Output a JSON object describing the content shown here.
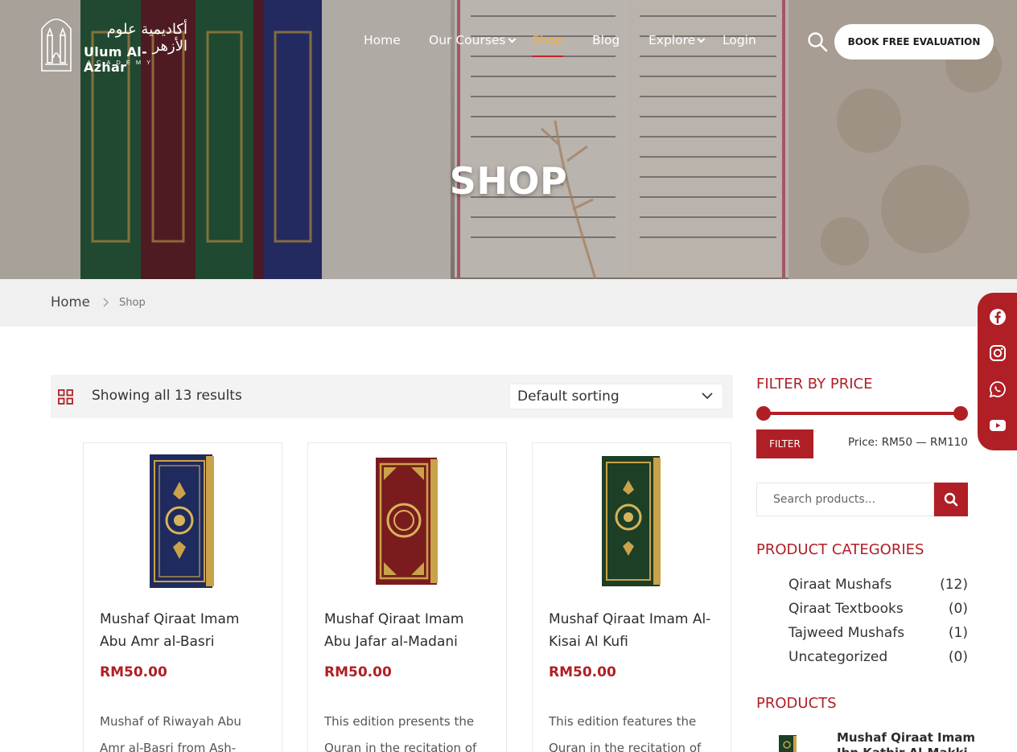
{
  "header": {
    "logo": {
      "name": "Ulum Al-Azhar",
      "tagline": "ACADEMY",
      "arabic": "أكاديمية علوم الأزهر"
    },
    "nav": [
      {
        "label": "Home",
        "dropdown": false,
        "active": false
      },
      {
        "label": "Our Courses",
        "dropdown": true,
        "active": false
      },
      {
        "label": "Shop",
        "dropdown": false,
        "active": true
      },
      {
        "label": "Blog",
        "dropdown": false,
        "active": false
      },
      {
        "label": "Explore",
        "dropdown": true,
        "active": false
      },
      {
        "label": "Login",
        "dropdown": false,
        "active": false
      }
    ],
    "search_icon": "search-icon",
    "cta_label": "BOOK FREE EVALUATION"
  },
  "hero": {
    "title": "SHOP"
  },
  "breadcrumb": {
    "home": "Home",
    "current": "Shop"
  },
  "social": [
    "facebook-icon",
    "instagram-icon",
    "whatsapp-icon",
    "youtube-icon"
  ],
  "toolbar": {
    "results_text": "Showing all 13 results",
    "sort_selected": "Default sorting"
  },
  "products": [
    {
      "title": "Mushaf Qiraat Imam Abu Amr al-Basri",
      "price": "RM50.00",
      "description": "Mushaf of Riwayah Abu Amr al-Basri from Ash-",
      "cover_color": "#1f2a5e"
    },
    {
      "title": "Mushaf Qiraat Imam Abu Jafar al-Madani",
      "price": "RM50.00",
      "description": "This edition presents the Quran in the recitation of",
      "cover_color": "#7a1c1e"
    },
    {
      "title": "Mushaf Qiraat Imam Al-Kisai Al Kufi",
      "price": "RM50.00",
      "description": "This edition features the Quran in the recitation of",
      "cover_color": "#1c3f26"
    }
  ],
  "sidebar": {
    "filter_heading": "FILTER BY PRICE",
    "filter_button": "FILTER",
    "price_range": "Price: RM50 — RM110",
    "search_placeholder": "Search products...",
    "categories_heading": "PRODUCT CATEGORIES",
    "categories": [
      {
        "name": "Qiraat Mushafs",
        "count": "(12)"
      },
      {
        "name": "Qiraat Textbooks",
        "count": "(0)"
      },
      {
        "name": "Tajweed Mushafs",
        "count": "(1)"
      },
      {
        "name": "Uncategorized",
        "count": "(0)"
      }
    ],
    "products_heading": "PRODUCTS",
    "featured_product": "Mushaf Qiraat Imam Ibn Kathir Al-Makki"
  },
  "colors": {
    "accent": "#b01f25",
    "nav_active": "#f2b23a",
    "toolbar_bg": "#f3f3f3",
    "crumb_bg": "#f0f0f0"
  }
}
